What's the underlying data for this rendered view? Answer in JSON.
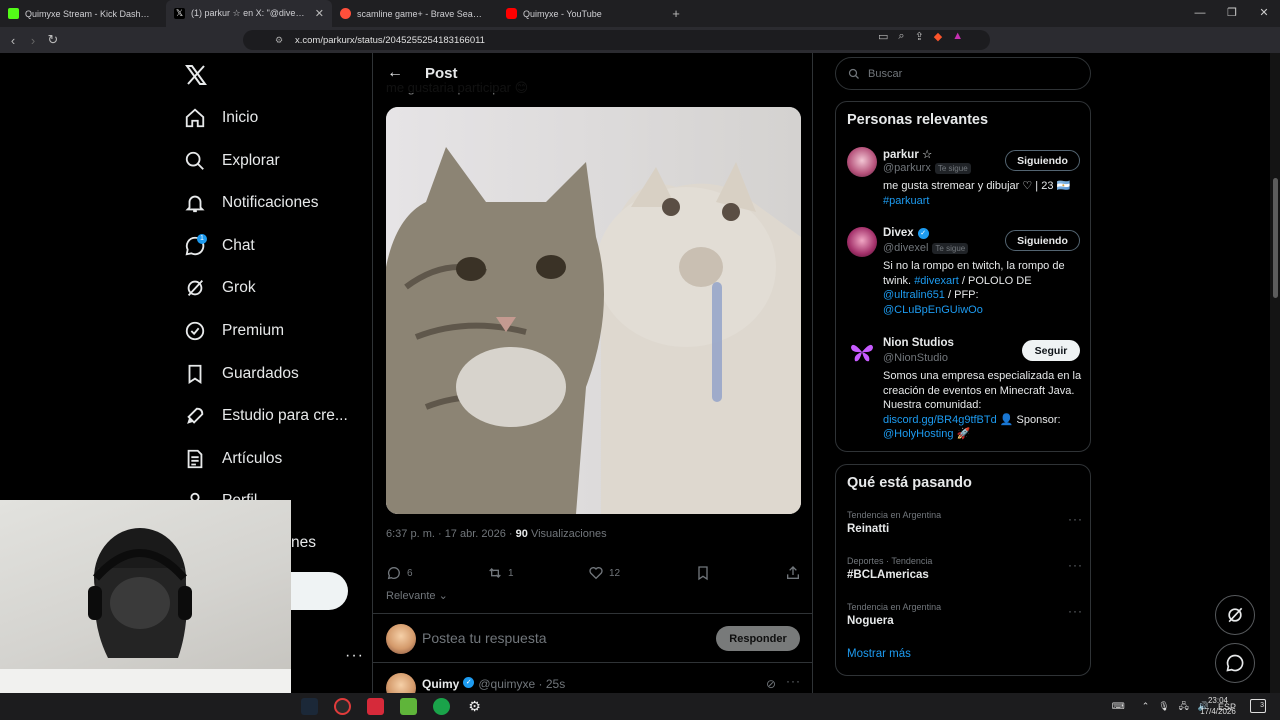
{
  "browser": {
    "tabs": [
      {
        "title": "Quimyxe Stream - Kick Dashboard",
        "color": "#53fc18"
      },
      {
        "title": "(1) parkur ☆ en X: \"@divexel @N",
        "color": "#ffffff"
      },
      {
        "title": "scamline game+ - Brave Search",
        "color": "#ff4f3b"
      },
      {
        "title": "Quimyxe - YouTube",
        "color": "#ff0000"
      }
    ],
    "url": "x.com/parkurx/status/2045255254183166011"
  },
  "nav": {
    "items": [
      {
        "label": "Inicio",
        "icon": "home-icon"
      },
      {
        "label": "Explorar",
        "icon": "search-icon"
      },
      {
        "label": "Notificaciones",
        "icon": "bell-icon"
      },
      {
        "label": "Chat",
        "icon": "chat-icon",
        "badge": "1"
      },
      {
        "label": "Grok",
        "icon": "grok-icon"
      },
      {
        "label": "Premium",
        "icon": "premium-icon"
      },
      {
        "label": "Guardados",
        "icon": "bookmark-icon"
      },
      {
        "label": "Estudio para cre...",
        "icon": "rocket-icon"
      },
      {
        "label": "Artículos",
        "icon": "article-icon"
      },
      {
        "label": "Perfil",
        "icon": "profile-icon"
      }
    ],
    "more_fragment": "nes"
  },
  "post": {
    "header_title": "Post",
    "clipped_text": "me gustaria participar 😊",
    "time": "6:37 p. m. · 17 abr. 2026 · ",
    "views_count": "90",
    "views_label": " Visualizaciones",
    "replies": "6",
    "reposts": "1",
    "likes": "12",
    "relevance_label": "Relevante",
    "reply_placeholder": "Postea tu respuesta",
    "reply_button": "Responder",
    "next_reply": {
      "name": "Quimy",
      "handle": "@quimyxe · 25s"
    }
  },
  "search": {
    "placeholder": "Buscar"
  },
  "relevant_people": {
    "title": "Personas relevantes",
    "people": [
      {
        "name": "parkur ☆",
        "handle": "@parkurx",
        "follows_you": "Te sigue",
        "button": "Siguiendo",
        "bio_text": "me gusta stremear y dibujar ♡ | 23 🇦🇷",
        "bio_link": "#parkuart"
      },
      {
        "name": "Divex",
        "handle": "@divexel",
        "follows_you": "Te sigue",
        "button": "Siguiendo",
        "bio_text": "Si no la rompo en twitch, la rompo de twink.",
        "bio_link": "#divexart",
        "bio_text2": " / POLOLO DE",
        "bio_link2": "@ultralin651",
        "bio_text3": " / PFP:",
        "bio_link3": "@CLuBpEnGUiwOo"
      },
      {
        "name": "Nion Studios",
        "handle": "@NionStudio",
        "button": "Seguir",
        "bio_text": "Somos una empresa especializada en la creación de eventos en Minecraft Java. Nuestra comunidad:",
        "bio_link": "discord.gg/BR4g9tfBTd",
        "bio_text2": " 👤 Sponsor:",
        "bio_link2": "@HolyHosting",
        "bio_text3": " 🚀"
      }
    ]
  },
  "trending": {
    "title": "Qué está pasando",
    "items": [
      {
        "category": "Tendencia en Argentina",
        "name": "Reinatti"
      },
      {
        "category": "Deportes · Tendencia",
        "name": "#BCLAmericas"
      },
      {
        "category": "Tendencia en Argentina",
        "name": "Noguera"
      }
    ],
    "show_more": "Mostrar más"
  },
  "taskbar": {
    "language": "ESP",
    "time": "23:04",
    "date": "17/4/2026",
    "notifications": "3"
  }
}
